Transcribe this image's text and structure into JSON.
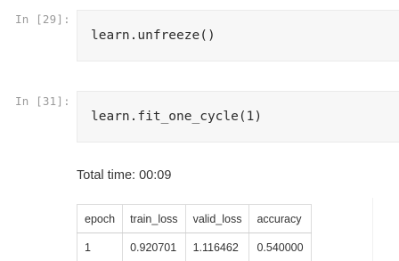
{
  "cells": [
    {
      "prompt": "In [29]:",
      "code": "learn.unfreeze()"
    },
    {
      "prompt": "In [31]:",
      "code": "learn.fit_one_cycle(1)"
    }
  ],
  "output": {
    "total_time": "Total time: 00:09",
    "table": {
      "headers": [
        "epoch",
        "train_loss",
        "valid_loss",
        "accuracy"
      ],
      "rows": [
        [
          "1",
          "0.920701",
          "1.116462",
          "0.540000"
        ]
      ]
    }
  }
}
